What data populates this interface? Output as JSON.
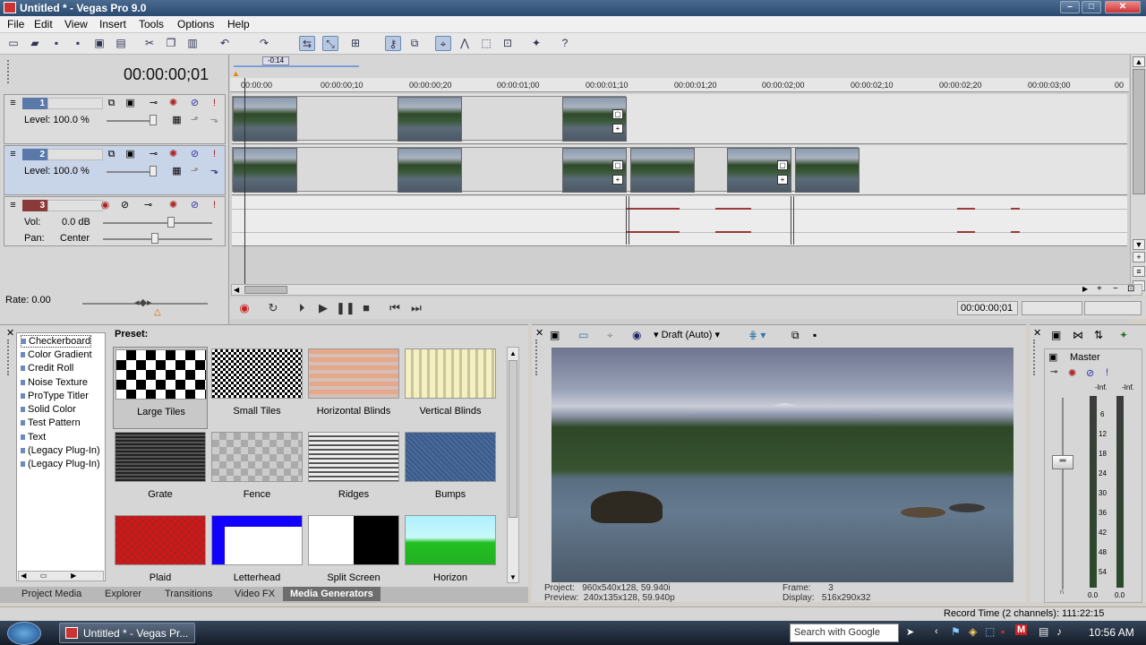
{
  "window": {
    "title": "Untitled * - Vegas Pro 9.0",
    "min": "–",
    "max": "□",
    "close": "✕"
  },
  "menu": [
    "File",
    "Edit",
    "View",
    "Insert",
    "Tools",
    "Options",
    "Help"
  ],
  "timeline": {
    "timecode": "00:00:00;01",
    "loop_marker": "-0:14",
    "ruler": [
      "00:00:00",
      "00:00:00;10",
      "00:00:00;20",
      "00:00:01;00",
      "00:00:01;10",
      "00:00:01;20",
      "00:00:02;00",
      "00:00:02;10",
      "00:00:02;20",
      "00:00:03;00"
    ],
    "rate": "Rate: 0.00",
    "cursor_time": "00:00:00;01"
  },
  "tracks": [
    {
      "number": "1",
      "type": "video",
      "level_label": "Level:",
      "level_value": "100.0 %",
      "color": "#5a78a8"
    },
    {
      "number": "2",
      "type": "video",
      "level_label": "Level:",
      "level_value": "100.0 %",
      "color": "#5a78a8"
    },
    {
      "number": "3",
      "type": "audio",
      "vol_label": "Vol:",
      "vol_value": "0.0 dB",
      "pan_label": "Pan:",
      "pan_value": "Center",
      "color": "#8a3a3a"
    }
  ],
  "media_generators": {
    "preset_label": "Preset:",
    "generators": [
      "Checkerboard",
      "Color Gradient",
      "Credit Roll",
      "Noise Texture",
      "ProType Titler",
      "Solid Color",
      "Test Pattern",
      "Text",
      "(Legacy Plug-In) T",
      "(Legacy Plug-In) V"
    ],
    "presets": [
      "Large Tiles",
      "Small Tiles",
      "Horizontal Blinds",
      "Vertical Blinds",
      "Grate",
      "Fence",
      "Ridges",
      "Bumps",
      "Plaid",
      "Letterhead",
      "Split Screen",
      "Horizon"
    ],
    "tabs": [
      "Project Media",
      "Explorer",
      "Transitions",
      "Video FX",
      "Media Generators"
    ],
    "active_tab": "Media Generators"
  },
  "video_preview": {
    "quality": "Draft (Auto)",
    "project_label": "Project:",
    "project_value": "960x540x128, 59.940i",
    "preview_label": "Preview:",
    "preview_value": "240x135x128, 59.940p",
    "frame_label": "Frame:",
    "frame_value": "3",
    "display_label": "Display:",
    "display_value": "516x290x32"
  },
  "mixer": {
    "title": "Master",
    "inf_left": "-Inf.",
    "inf_right": "-Inf.",
    "scale": [
      "6",
      "12",
      "18",
      "24",
      "30",
      "36",
      "42",
      "48",
      "54"
    ],
    "bottom_left": "0.0",
    "bottom_right": "0.0"
  },
  "status": {
    "record_time": "Record Time (2 channels): 111:22:15"
  },
  "taskbar": {
    "item": "Untitled * - Vegas Pr...",
    "search": "Search with Google",
    "time": "10:56 AM"
  }
}
